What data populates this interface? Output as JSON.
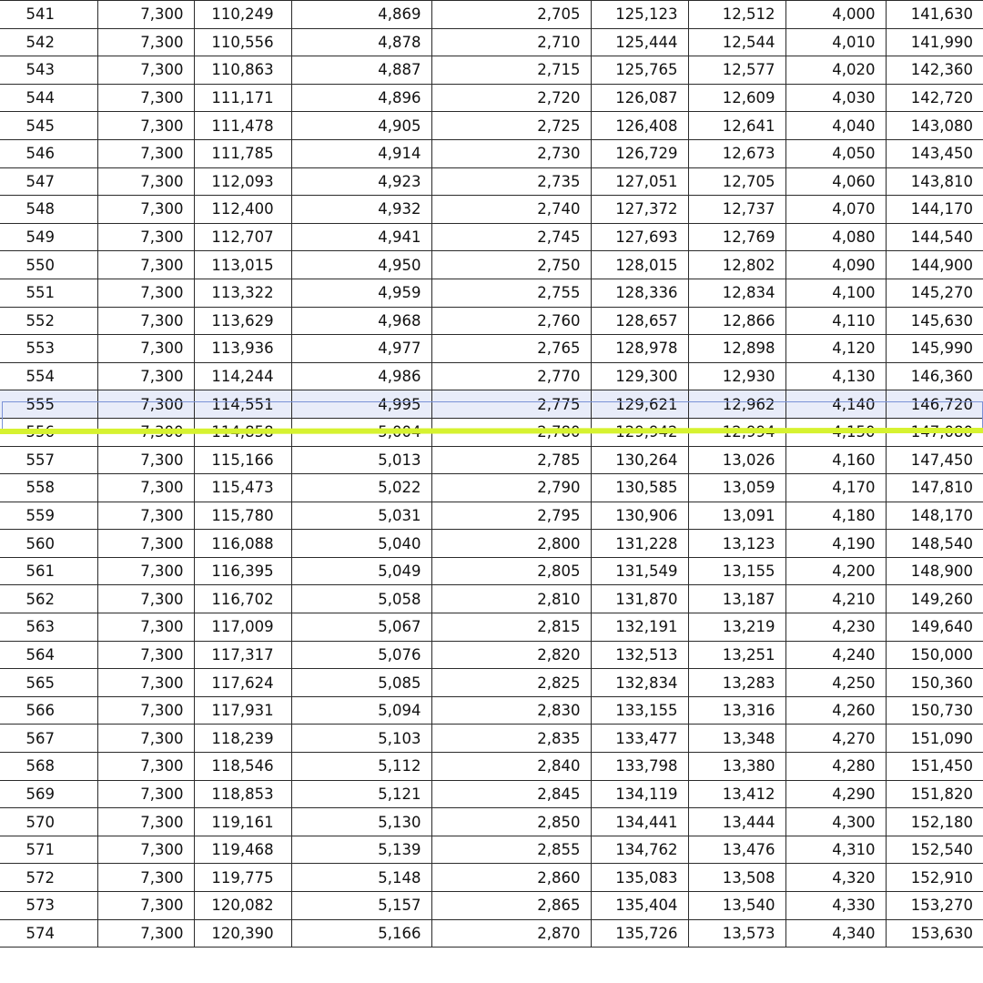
{
  "sheet": {
    "selected_row_id": "555",
    "colors": {
      "selection_fill": "#e8ecf9",
      "selection_border": "#7b92d6",
      "highlight_stroke": "#d6f230",
      "grid_line": "#2b2b2b"
    },
    "rows": [
      [
        "541",
        "7,300",
        "110,249",
        "4,869",
        "2,705",
        "125,123",
        "12,512",
        "4,000",
        "141,630"
      ],
      [
        "542",
        "7,300",
        "110,556",
        "4,878",
        "2,710",
        "125,444",
        "12,544",
        "4,010",
        "141,990"
      ],
      [
        "543",
        "7,300",
        "110,863",
        "4,887",
        "2,715",
        "125,765",
        "12,577",
        "4,020",
        "142,360"
      ],
      [
        "544",
        "7,300",
        "111,171",
        "4,896",
        "2,720",
        "126,087",
        "12,609",
        "4,030",
        "142,720"
      ],
      [
        "545",
        "7,300",
        "111,478",
        "4,905",
        "2,725",
        "126,408",
        "12,641",
        "4,040",
        "143,080"
      ],
      [
        "546",
        "7,300",
        "111,785",
        "4,914",
        "2,730",
        "126,729",
        "12,673",
        "4,050",
        "143,450"
      ],
      [
        "547",
        "7,300",
        "112,093",
        "4,923",
        "2,735",
        "127,051",
        "12,705",
        "4,060",
        "143,810"
      ],
      [
        "548",
        "7,300",
        "112,400",
        "4,932",
        "2,740",
        "127,372",
        "12,737",
        "4,070",
        "144,170"
      ],
      [
        "549",
        "7,300",
        "112,707",
        "4,941",
        "2,745",
        "127,693",
        "12,769",
        "4,080",
        "144,540"
      ],
      [
        "550",
        "7,300",
        "113,015",
        "4,950",
        "2,750",
        "128,015",
        "12,802",
        "4,090",
        "144,900"
      ],
      [
        "551",
        "7,300",
        "113,322",
        "4,959",
        "2,755",
        "128,336",
        "12,834",
        "4,100",
        "145,270"
      ],
      [
        "552",
        "7,300",
        "113,629",
        "4,968",
        "2,760",
        "128,657",
        "12,866",
        "4,110",
        "145,630"
      ],
      [
        "553",
        "7,300",
        "113,936",
        "4,977",
        "2,765",
        "128,978",
        "12,898",
        "4,120",
        "145,990"
      ],
      [
        "554",
        "7,300",
        "114,244",
        "4,986",
        "2,770",
        "129,300",
        "12,930",
        "4,130",
        "146,360"
      ],
      [
        "555",
        "7,300",
        "114,551",
        "4,995",
        "2,775",
        "129,621",
        "12,962",
        "4,140",
        "146,720"
      ],
      [
        "556",
        "7,300",
        "114,858",
        "5,004",
        "2,780",
        "129,942",
        "12,994",
        "4,150",
        "147,080"
      ],
      [
        "557",
        "7,300",
        "115,166",
        "5,013",
        "2,785",
        "130,264",
        "13,026",
        "4,160",
        "147,450"
      ],
      [
        "558",
        "7,300",
        "115,473",
        "5,022",
        "2,790",
        "130,585",
        "13,059",
        "4,170",
        "147,810"
      ],
      [
        "559",
        "7,300",
        "115,780",
        "5,031",
        "2,795",
        "130,906",
        "13,091",
        "4,180",
        "148,170"
      ],
      [
        "560",
        "7,300",
        "116,088",
        "5,040",
        "2,800",
        "131,228",
        "13,123",
        "4,190",
        "148,540"
      ],
      [
        "561",
        "7,300",
        "116,395",
        "5,049",
        "2,805",
        "131,549",
        "13,155",
        "4,200",
        "148,900"
      ],
      [
        "562",
        "7,300",
        "116,702",
        "5,058",
        "2,810",
        "131,870",
        "13,187",
        "4,210",
        "149,260"
      ],
      [
        "563",
        "7,300",
        "117,009",
        "5,067",
        "2,815",
        "132,191",
        "13,219",
        "4,230",
        "149,640"
      ],
      [
        "564",
        "7,300",
        "117,317",
        "5,076",
        "2,820",
        "132,513",
        "13,251",
        "4,240",
        "150,000"
      ],
      [
        "565",
        "7,300",
        "117,624",
        "5,085",
        "2,825",
        "132,834",
        "13,283",
        "4,250",
        "150,360"
      ],
      [
        "566",
        "7,300",
        "117,931",
        "5,094",
        "2,830",
        "133,155",
        "13,316",
        "4,260",
        "150,730"
      ],
      [
        "567",
        "7,300",
        "118,239",
        "5,103",
        "2,835",
        "133,477",
        "13,348",
        "4,270",
        "151,090"
      ],
      [
        "568",
        "7,300",
        "118,546",
        "5,112",
        "2,840",
        "133,798",
        "13,380",
        "4,280",
        "151,450"
      ],
      [
        "569",
        "7,300",
        "118,853",
        "5,121",
        "2,845",
        "134,119",
        "13,412",
        "4,290",
        "151,820"
      ],
      [
        "570",
        "7,300",
        "119,161",
        "5,130",
        "2,850",
        "134,441",
        "13,444",
        "4,300",
        "152,180"
      ],
      [
        "571",
        "7,300",
        "119,468",
        "5,139",
        "2,855",
        "134,762",
        "13,476",
        "4,310",
        "152,540"
      ],
      [
        "572",
        "7,300",
        "119,775",
        "5,148",
        "2,860",
        "135,083",
        "13,508",
        "4,320",
        "152,910"
      ],
      [
        "573",
        "7,300",
        "120,082",
        "5,157",
        "2,865",
        "135,404",
        "13,540",
        "4,330",
        "153,270"
      ],
      [
        "574",
        "7,300",
        "120,390",
        "5,166",
        "2,870",
        "135,726",
        "13,573",
        "4,340",
        "153,630"
      ]
    ]
  }
}
